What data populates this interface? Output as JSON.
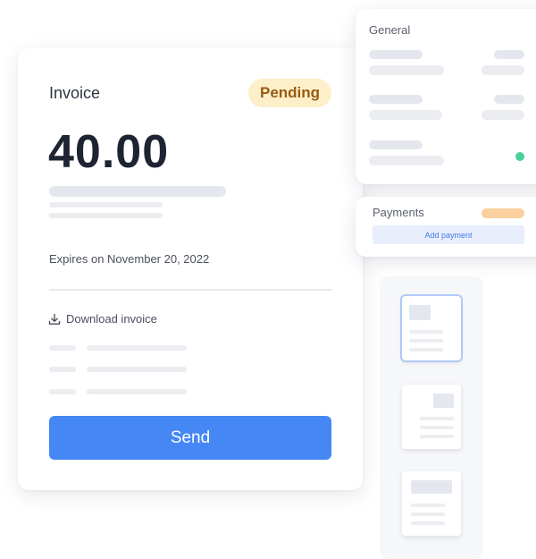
{
  "invoice": {
    "title": "Invoice",
    "status": "Pending",
    "amount": "40.00",
    "expires": "Expires on November 20, 2022",
    "download_label": "Download invoice",
    "send_label": "Send"
  },
  "general": {
    "title": "General",
    "status_dot_color": "#4dcf9a"
  },
  "payments": {
    "title": "Payments",
    "add_payment_label": "Add payment"
  },
  "colors": {
    "primary": "#4587f4",
    "pending_bg": "#fdefc9",
    "pending_text": "#9a5a13",
    "payments_badge": "#fbd09e"
  },
  "icons": {
    "download": "download-icon"
  }
}
